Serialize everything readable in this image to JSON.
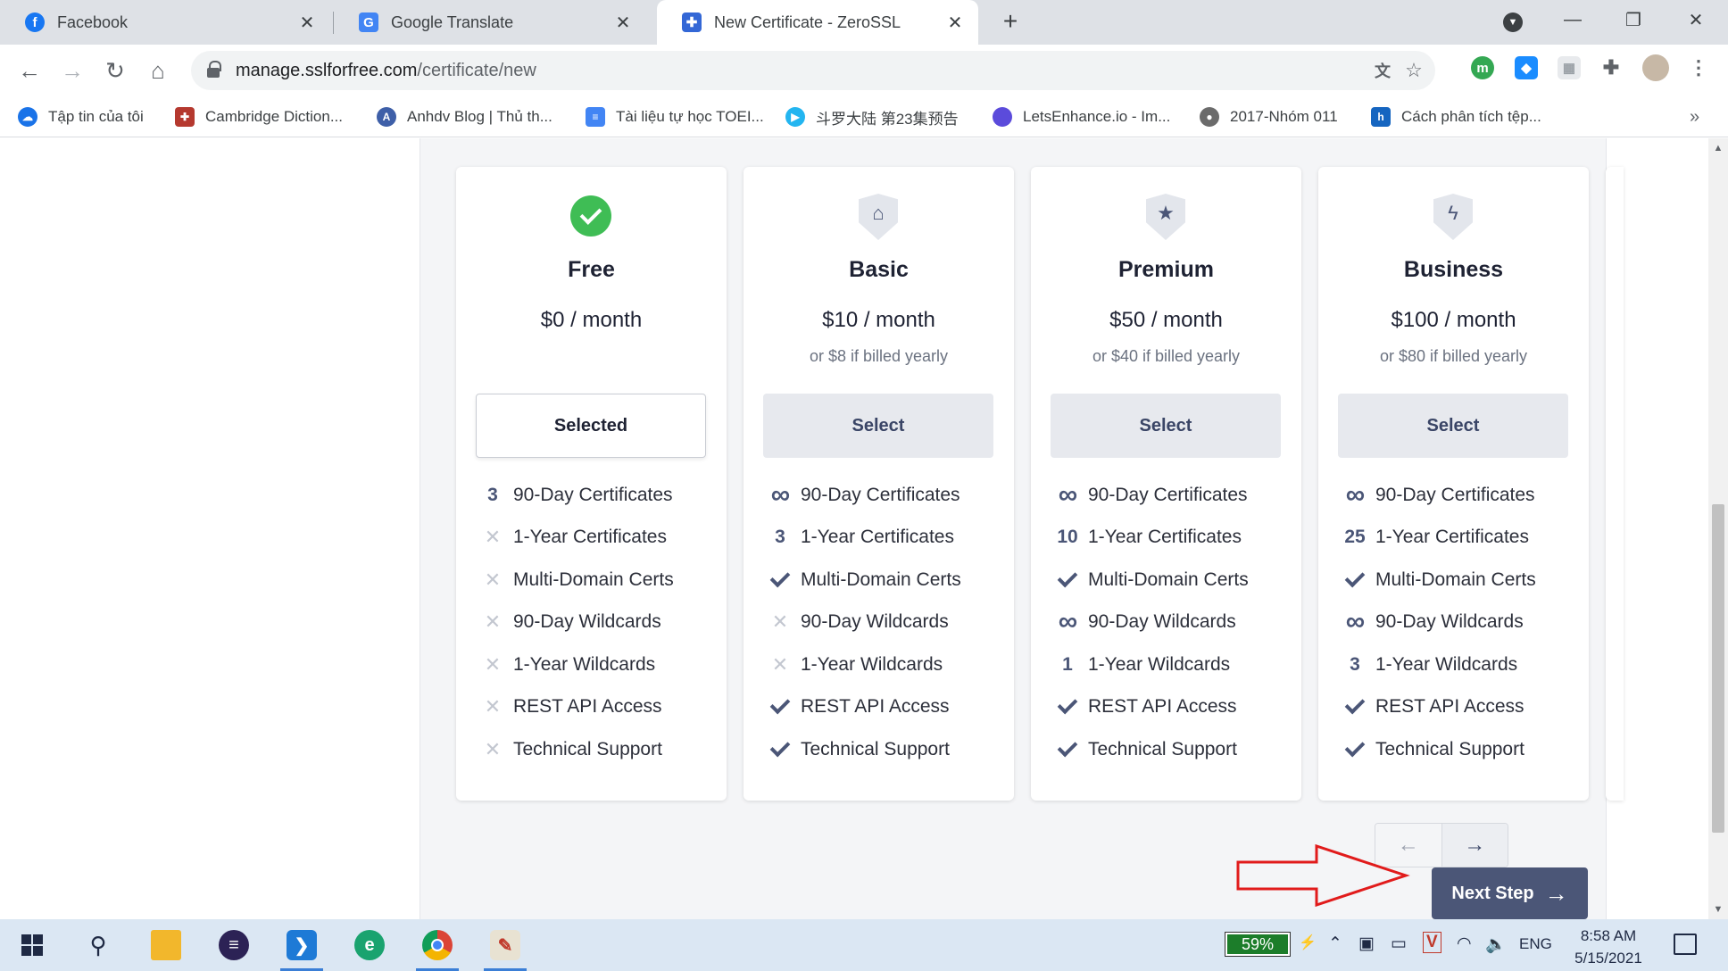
{
  "browser": {
    "tabs": [
      {
        "title": "Facebook",
        "icon": "facebook-icon"
      },
      {
        "title": "Google Translate",
        "icon": "google-translate-icon"
      },
      {
        "title": "New Certificate - ZeroSSL",
        "icon": "puzzle-icon"
      }
    ],
    "url_domain": "manage.sslforfree.com",
    "url_path": "/certificate/new",
    "bookmarks": [
      "Tập tin của tôi",
      "Cambridge Diction...",
      "Anhdv Blog | Thủ th...",
      "Tài liệu tự học TOEI...",
      "斗罗大陆 第23集预告",
      "LetsEnhance.io - Im...",
      "2017-Nhóm 011",
      "Cách phân tích tệp..."
    ]
  },
  "plans": [
    {
      "name": "Free",
      "price": "$0 / month",
      "yearly": "",
      "button": "Selected",
      "features": [
        {
          "mark": "3",
          "label": "90-Day Certificates"
        },
        {
          "mark": "cross",
          "label": "1-Year Certificates"
        },
        {
          "mark": "cross",
          "label": "Multi-Domain Certs"
        },
        {
          "mark": "cross",
          "label": "90-Day Wildcards"
        },
        {
          "mark": "cross",
          "label": "1-Year Wildcards"
        },
        {
          "mark": "cross",
          "label": "REST API Access"
        },
        {
          "mark": "cross",
          "label": "Technical Support"
        }
      ]
    },
    {
      "name": "Basic",
      "price": "$10 / month",
      "yearly": "or $8 if billed yearly",
      "button": "Select",
      "features": [
        {
          "mark": "infinity",
          "label": "90-Day Certificates"
        },
        {
          "mark": "3",
          "label": "1-Year Certificates"
        },
        {
          "mark": "check",
          "label": "Multi-Domain Certs"
        },
        {
          "mark": "cross",
          "label": "90-Day Wildcards"
        },
        {
          "mark": "cross",
          "label": "1-Year Wildcards"
        },
        {
          "mark": "check",
          "label": "REST API Access"
        },
        {
          "mark": "check",
          "label": "Technical Support"
        }
      ]
    },
    {
      "name": "Premium",
      "price": "$50 / month",
      "yearly": "or $40 if billed yearly",
      "button": "Select",
      "features": [
        {
          "mark": "infinity",
          "label": "90-Day Certificates"
        },
        {
          "mark": "10",
          "label": "1-Year Certificates"
        },
        {
          "mark": "check",
          "label": "Multi-Domain Certs"
        },
        {
          "mark": "infinity",
          "label": "90-Day Wildcards"
        },
        {
          "mark": "1",
          "label": "1-Year Wildcards"
        },
        {
          "mark": "check",
          "label": "REST API Access"
        },
        {
          "mark": "check",
          "label": "Technical Support"
        }
      ]
    },
    {
      "name": "Business",
      "price": "$100 / month",
      "yearly": "or $80 if billed yearly",
      "button": "Select",
      "features": [
        {
          "mark": "infinity",
          "label": "90-Day Certificates"
        },
        {
          "mark": "25",
          "label": "1-Year Certificates"
        },
        {
          "mark": "check",
          "label": "Multi-Domain Certs"
        },
        {
          "mark": "infinity",
          "label": "90-Day Wildcards"
        },
        {
          "mark": "3",
          "label": "1-Year Wildcards"
        },
        {
          "mark": "check",
          "label": "REST API Access"
        },
        {
          "mark": "check",
          "label": "Technical Support"
        }
      ]
    }
  ],
  "pager": {
    "prev": "←",
    "next": "→"
  },
  "next_step": {
    "label": "Next Step"
  },
  "colors": {
    "accent": "#4b5677",
    "check_green": "#3fbd55",
    "annotation_red": "#e11b1b"
  },
  "taskbar": {
    "battery": "59%",
    "language": "ENG",
    "time": "8:58 AM",
    "date": "5/15/2021"
  }
}
